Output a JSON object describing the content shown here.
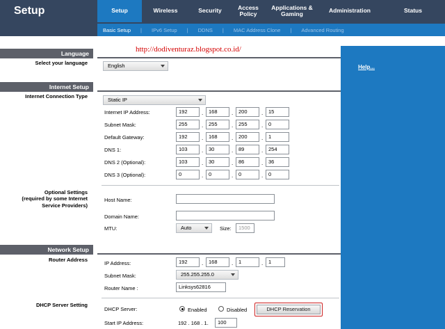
{
  "brand": "Setup",
  "tabs": [
    {
      "label": "Setup"
    },
    {
      "label": "Wireless"
    },
    {
      "label": "Security"
    },
    {
      "label": "Access Policy"
    },
    {
      "label": "Applications & Gaming"
    },
    {
      "label": "Administration"
    },
    {
      "label": "Status"
    }
  ],
  "subnav": [
    "Basic Setup",
    "IPv6 Setup",
    "DDNS",
    "MAC Address Clone",
    "Advanced Routing"
  ],
  "watermark": "http://dodiventuraz.blogspot.co.id/",
  "help_link": "Help...",
  "language": {
    "section": "Language",
    "label": "Select your language",
    "value": "English"
  },
  "internet": {
    "section": "Internet Setup",
    "label": "Internet Connection Type",
    "conn_type": "Static IP",
    "fields": {
      "ip_label": "Internet IP Address:",
      "ip": [
        "192",
        "168",
        "200",
        "15"
      ],
      "mask_label": "Subnet Mask:",
      "mask": [
        "255",
        "255",
        "255",
        "0"
      ],
      "gw_label": "Default Gateway:",
      "gw": [
        "192",
        "168",
        "200",
        "1"
      ],
      "dns1_label": "DNS 1:",
      "dns1": [
        "103",
        "30",
        "89",
        "254"
      ],
      "dns2_label": "DNS 2 (Optional):",
      "dns2": [
        "103",
        "30",
        "86",
        "36"
      ],
      "dns3_label": "DNS 3 (Optional):",
      "dns3": [
        "0",
        "0",
        "0",
        "0"
      ]
    }
  },
  "optional": {
    "label_line1": "Optional Settings",
    "label_line2": "(required by some Internet",
    "label_line3": "Service Providers)",
    "host_label": "Host Name:",
    "host_value": "",
    "domain_label": "Domain Name:",
    "domain_value": "",
    "mtu_label": "MTU:",
    "mtu_value": "Auto",
    "size_label": "Size:",
    "size_value": "1500"
  },
  "network": {
    "section": "Network Setup",
    "router_label": "Router Address",
    "ip_label": "IP Address:",
    "ip": [
      "192",
      "168",
      "1",
      "1"
    ],
    "mask_label": "Subnet Mask:",
    "mask_value": "255.255.255.0",
    "name_label": "Router Name :",
    "name_value": "Linksys62816"
  },
  "dhcp": {
    "label": "DHCP Server Setting",
    "server_label": "DHCP Server:",
    "enabled": "Enabled",
    "disabled": "Disabled",
    "reservation": "DHCP Reservation",
    "start_label": "Start IP Address:",
    "start_prefix": "192 . 168 . 1.",
    "start_value": "100"
  }
}
